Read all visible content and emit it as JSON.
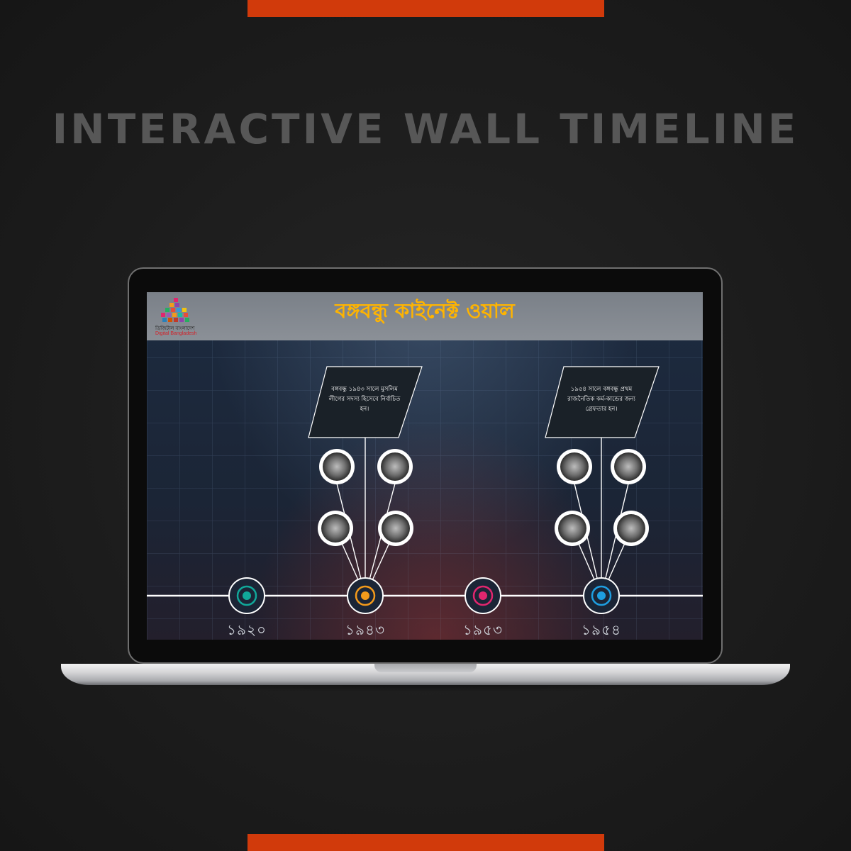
{
  "headline": "INTERACTIVE WALL TIMELINE",
  "colors": {
    "accent": "#d13a0b",
    "app_title": "#ffb400",
    "year_1920": "#11a89a",
    "year_1943": "#f39a1b",
    "year_1953": "#e0266e",
    "year_1954": "#1e9ee0"
  },
  "app": {
    "title": "বঙ্গবন্ধু কাইনেক্ট ওয়াল",
    "logo": {
      "text_bn": "ডিজিটাল বাংলাদেশ",
      "text_en": "Digital Bangladesh"
    }
  },
  "timeline": {
    "years": [
      "১৯২০",
      "১৯৪৩",
      "১৯৫৩",
      "১৯৫৪"
    ],
    "events": [
      {
        "year": "১৯৪৩",
        "lines": [
          "বঙ্গবন্ধু ১৯৪৩ সালে মুসলিম",
          "লীগের সদস্য হিসেবে নির্বাচিত",
          "হন।"
        ],
        "photos": [
          "photo-1943-1",
          "photo-1943-2",
          "photo-1943-3",
          "photo-1943-4"
        ]
      },
      {
        "year": "১৯৫৪",
        "lines": [
          "১৯৫৪ সালে বঙ্গবন্ধু প্রথম",
          "রাজনৈতিক কর্ম-কান্ডের জন্য",
          "গ্রেফতার হন।"
        ],
        "photos": [
          "photo-1954-1",
          "photo-1954-2",
          "photo-1954-3",
          "photo-1954-4"
        ]
      }
    ]
  }
}
